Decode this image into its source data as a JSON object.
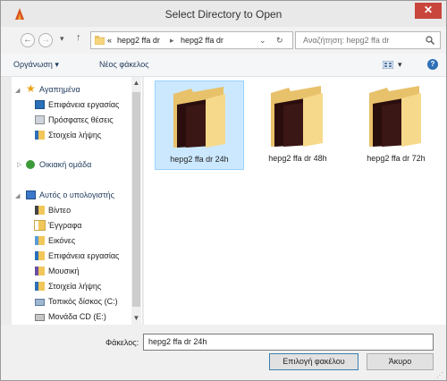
{
  "window": {
    "title": "Select Directory to Open",
    "close_label": "✕"
  },
  "nav": {
    "back_label": "←",
    "forward_label": "→",
    "recent_label": "▾",
    "up_label": "↑",
    "breadcrumb_prefix": "«",
    "breadcrumb": [
      "hepg2 ffa dr",
      "hepg2 ffa dr"
    ],
    "breadcrumb_sep": "▸",
    "dropdown_label": "⌄",
    "refresh_label": "↻",
    "search_placeholder": "Αναζήτηση: hepg2 ffa dr",
    "search_icon": "search-icon"
  },
  "toolbar": {
    "organize_label": "Οργάνωση ▾",
    "new_folder_label": "Νέος φάκελος",
    "view_label": "▾",
    "help_label": "?"
  },
  "sidebar": {
    "favorites": {
      "label": "Αγαπημένα",
      "items": [
        {
          "label": "Επιφάνεια εργασίας",
          "icon": "desktop-icon"
        },
        {
          "label": "Πρόσφατες θέσεις",
          "icon": "recent-places-icon"
        },
        {
          "label": "Στοιχεία λήψης",
          "icon": "downloads-icon"
        }
      ]
    },
    "homegroup": {
      "label": "Οικιακή ομάδα"
    },
    "computer": {
      "label": "Αυτός ο υπολογιστής",
      "items": [
        {
          "label": "Βίντεο",
          "icon": "videos-icon"
        },
        {
          "label": "Έγγραφα",
          "icon": "documents-icon"
        },
        {
          "label": "Εικόνες",
          "icon": "pictures-icon"
        },
        {
          "label": "Επιφάνεια εργασίας",
          "icon": "desktop-icon"
        },
        {
          "label": "Μουσική",
          "icon": "music-icon"
        },
        {
          "label": "Στοιχεία λήψης",
          "icon": "downloads-icon"
        },
        {
          "label": "Τοπικός δίσκος (C:)",
          "icon": "drive-icon"
        },
        {
          "label": "Μονάδα CD (E:)",
          "icon": "cd-drive-icon"
        }
      ]
    },
    "scroll_up": "▲",
    "scroll_down": "▼"
  },
  "folders": [
    {
      "label": "hepg2 ffa dr 24h",
      "selected": true
    },
    {
      "label": "hepg2 ffa dr 48h",
      "selected": false
    },
    {
      "label": "hepg2 ffa dr 72h",
      "selected": false
    }
  ],
  "bottom": {
    "folder_label": "Φάκελος:",
    "folder_value": "hepg2 ffa dr 24h",
    "select_button": "Επιλογή φακέλου",
    "cancel_button": "Άκυρο",
    "grip": "⋰"
  },
  "colors": {
    "selection": "#cce8ff",
    "folder": "#f6d57e",
    "close": "#c8463c"
  }
}
